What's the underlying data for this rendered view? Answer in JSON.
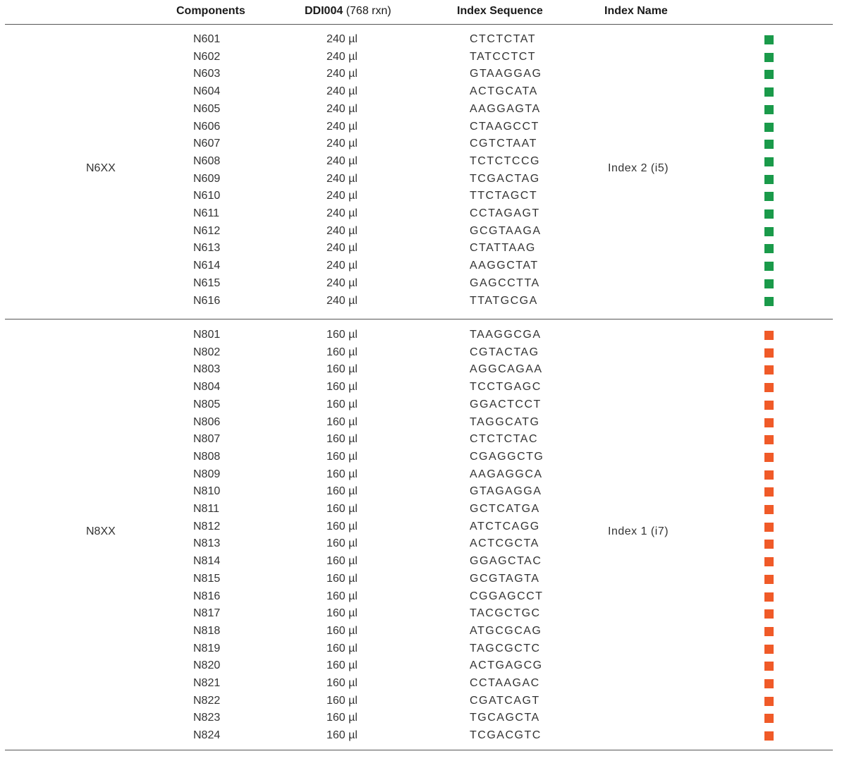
{
  "header": {
    "components": "Components",
    "volume_bold": "DDI004",
    "volume_paren": "(768 rxn)",
    "sequence": "Index Sequence",
    "name": "Index Name"
  },
  "groups": [
    {
      "label": "N6XX",
      "index_name": "Index 2 (i5)",
      "color": "#1a9a4a",
      "rows": [
        {
          "component": "N601",
          "volume": "240 µl",
          "sequence": "CTCTCTAT"
        },
        {
          "component": "N602",
          "volume": "240 µl",
          "sequence": "TATCCTCT"
        },
        {
          "component": "N603",
          "volume": "240 µl",
          "sequence": "GTAAGGAG"
        },
        {
          "component": "N604",
          "volume": "240 µl",
          "sequence": "ACTGCATA"
        },
        {
          "component": "N605",
          "volume": "240 µl",
          "sequence": "AAGGAGTA"
        },
        {
          "component": "N606",
          "volume": "240 µl",
          "sequence": "CTAAGCCT"
        },
        {
          "component": "N607",
          "volume": "240 µl",
          "sequence": "CGTCTAAT"
        },
        {
          "component": "N608",
          "volume": "240 µl",
          "sequence": "TCTCTCCG"
        },
        {
          "component": "N609",
          "volume": "240 µl",
          "sequence": "TCGACTAG"
        },
        {
          "component": "N610",
          "volume": "240 µl",
          "sequence": "TTCTAGCT"
        },
        {
          "component": "N611",
          "volume": "240 µl",
          "sequence": "CCTAGAGT"
        },
        {
          "component": "N612",
          "volume": "240 µl",
          "sequence": "GCGTAAGA"
        },
        {
          "component": "N613",
          "volume": "240 µl",
          "sequence": "CTATTAAG"
        },
        {
          "component": "N614",
          "volume": "240 µl",
          "sequence": "AAGGCTAT"
        },
        {
          "component": "N615",
          "volume": "240 µl",
          "sequence": "GAGCCTTA"
        },
        {
          "component": "N616",
          "volume": "240 µl",
          "sequence": "TTATGCGA"
        }
      ]
    },
    {
      "label": "N8XX",
      "index_name": "Index 1 (i7)",
      "color": "#f05a28",
      "rows": [
        {
          "component": "N801",
          "volume": "160 µl",
          "sequence": "TAAGGCGA"
        },
        {
          "component": "N802",
          "volume": "160 µl",
          "sequence": "CGTACTAG"
        },
        {
          "component": "N803",
          "volume": "160 µl",
          "sequence": "AGGCAGAA"
        },
        {
          "component": "N804",
          "volume": "160 µl",
          "sequence": "TCCTGAGC"
        },
        {
          "component": "N805",
          "volume": "160 µl",
          "sequence": "GGACTCCT"
        },
        {
          "component": "N806",
          "volume": "160 µl",
          "sequence": "TAGGCATG"
        },
        {
          "component": "N807",
          "volume": "160 µl",
          "sequence": "CTCTCTAC"
        },
        {
          "component": "N808",
          "volume": "160 µl",
          "sequence": "CGAGGCTG"
        },
        {
          "component": "N809",
          "volume": "160 µl",
          "sequence": "AAGAGGCA"
        },
        {
          "component": "N810",
          "volume": "160 µl",
          "sequence": "GTAGAGGA"
        },
        {
          "component": "N811",
          "volume": "160 µl",
          "sequence": "GCTCATGA"
        },
        {
          "component": "N812",
          "volume": "160 µl",
          "sequence": "ATCTCAGG"
        },
        {
          "component": "N813",
          "volume": "160 µl",
          "sequence": "ACTCGCTA"
        },
        {
          "component": "N814",
          "volume": "160 µl",
          "sequence": "GGAGCTAC"
        },
        {
          "component": "N815",
          "volume": "160 µl",
          "sequence": "GCGTAGTA"
        },
        {
          "component": "N816",
          "volume": "160 µl",
          "sequence": "CGGAGCCT"
        },
        {
          "component": "N817",
          "volume": "160 µl",
          "sequence": "TACGCTGC"
        },
        {
          "component": "N818",
          "volume": "160 µl",
          "sequence": "ATGCGCAG"
        },
        {
          "component": "N819",
          "volume": "160 µl",
          "sequence": "TAGCGCTC"
        },
        {
          "component": "N820",
          "volume": "160 µl",
          "sequence": "ACTGAGCG"
        },
        {
          "component": "N821",
          "volume": "160 µl",
          "sequence": "CCTAAGAC"
        },
        {
          "component": "N822",
          "volume": "160 µl",
          "sequence": "CGATCAGT"
        },
        {
          "component": "N823",
          "volume": "160 µl",
          "sequence": "TGCAGCTA"
        },
        {
          "component": "N824",
          "volume": "160 µl",
          "sequence": "TCGACGTC"
        }
      ]
    }
  ]
}
